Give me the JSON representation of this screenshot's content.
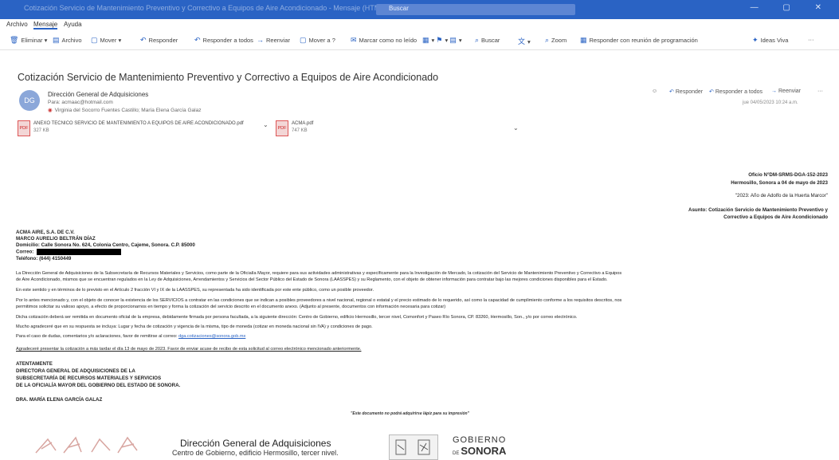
{
  "window": {
    "title": "Cotización Servicio de Mantenimiento Preventivo y Correctivo a Equipos de Aire Acondicionado - Mensaje (HTML)",
    "search_placeholder": "Buscar"
  },
  "menu": [
    "Archivo",
    "Mensaje",
    "Ayuda"
  ],
  "ribbon": {
    "eliminar": "Eliminar",
    "archivo": "Archivo",
    "mover": "Mover",
    "responder": "Responder",
    "responder_todos": "Responder a todos",
    "reenviar": "Reenviar",
    "mover1": "Mover a ?",
    "marcar": "Marcar como no leído",
    "buscar": "Buscar",
    "zoom": "Zoom",
    "responder_reunion": "Responder con reunión de programación",
    "ideas": "Ideas Viva",
    "more": "···"
  },
  "email": {
    "subject": "Cotización Servicio de Mantenimiento Preventivo y Correctivo a Equipos de Aire Acondicionado",
    "sender_initials": "DG",
    "sender_name": "Dirección General de Adquisiciones",
    "sender_email": "Para: acmaac@hotmail.com",
    "to_line": "Virginia del Socorro Fuentes Castillo; María Elena García Galaz",
    "actions": {
      "reply": "Responder",
      "reply_all": "Responder a todos",
      "forward": "Reenviar",
      "more": "···"
    },
    "date": "jue 04/05/2023 10:24 a.m.",
    "attachments": [
      {
        "name": "ANEXO TECNICO SERVICIO DE MANTENIMIENTO A EQUIPOS DE AIRE ACONDICIONADO.pdf",
        "size": "327 KB"
      },
      {
        "name": "ACMA.pdf",
        "size": "747 KB"
      }
    ]
  },
  "letter": {
    "oficio": "Oficio N°DM-SRMS-DGA-152-2023",
    "lugar_fecha": "Hermosillo, Sonora a 04 de mayo de 2023",
    "lema": "\"2023: Año de Adolfo de la Huerta Marcor\"",
    "asunto_1": "Asunto: Cotización Servicio de Mantenimiento Preventivo y",
    "asunto_2": "Correctivo a Equipos de Aire Acondicionado",
    "dest_1": "ACMA AIRE, S.A. DE C.V.",
    "dest_2": "MARCO AURELIO BELTRÁN DÍAZ",
    "dest_3": "Domicilio: Calle Sonora No. 624, Colonia Centro, Cajeme, Sonora. C.P. 85000",
    "dest_4": "Correo:",
    "dest_5": "Teléfono: (644) 4150449",
    "p1_a": "La Dirección General de Adquisiciones de la Subsecretaría de Recursos Materiales y Servicios, como parte de la Oficialía Mayor, requiere para sus actividades administrativas y específicamente para la Investigación de Mercado, la cotización del Servicio de Mantenimiento Preventivo y Correctivo a Equipos",
    "p1_b": "de Aire Acondicionado, mismos que se encuentran regulados en la Ley de Adquisiciones, Arrendamientos y Servicios del Sector Público del Estado de Sonora (LAASSPES) y su Reglamento, con el objeto de obtener información para contratar bajo las mejores condiciones disponibles para el Estado.",
    "p2": "En este sentido y en términos de lo previsto en el Artículo 2 fracción VI y IX de la LAASSPES, su representada ha sido identificada por este ente público, como un posible proveedor.",
    "p3_a": "Por lo antes mencionado y, con el objeto de conocer la existencia de los SERVICIOS a contratar en las condiciones que se indican a posibles proveedores a nivel nacional, regional o estatal y el precio estimado de lo requerido, así como la capacidad de cumplimiento conforme a los requisitos descritos, nos",
    "p3_b": "permitimos solicitar su valioso apoyo, a efecto de proporcionarnos en tiempo y forma la cotización del servicio descrito en el documento anexo. (Adjunto al presente, documentos con información necesaria para cotizar)",
    "p4": "Dicha cotización deberá ser remitida en documento oficial de la empresa, debidamente firmada por persona facultada, a la siguiente dirección: Centro de Gobierno, edificio Hermosillo, tercer nivel, Comonfort y Paseo Río Sonora, CP. 83260, Hermosillo, Son., y/o por correo electrónico.",
    "p5": "Mucho agradeceré que en su respuesta se incluya: Lugar y fecha de cotización y vigencia de la misma, tipo de moneda (cotizar en moneda nacional sin IVA) y condiciones de pago.",
    "p6": "Para el caso de dudas, comentarios y/o aclaraciones, favor de remitirse al correo:",
    "p6_link": "dga.cotizaciones@sonora.gob.mx",
    "p7": "Agradeceré presentar la cotización a más tardar el día 13 de mayo de 2023. Favor de enviar acuse de recibo de esta solicitud al correo electrónico mencionado anteriormente.",
    "firma_1": "ATENTAMENTE",
    "firma_2": "DIRECTORA GENERAL DE ADQUISICIONES DE LA",
    "firma_3": "SUBSECRETARÍA DE RECURSOS MATERIALES Y SERVICIOS",
    "firma_4": "DE LA OFICIALÍA MAYOR DEL GOBIERNO DEL ESTADO DE SONORA.",
    "firma_5": "DRA. MARÍA ELENA GARCÍA GALAZ",
    "nota": "\"Este documento no podrá adquirirse lápiz para su impresión\""
  },
  "footer": {
    "title": "Dirección General de Adquisiciones",
    "subtitle": "Centro de Gobierno, edificio Hermosillo, tercer nivel.",
    "gob_1": "GOBIERNO",
    "gob_prefix": "DE",
    "gob_2": "SONORA"
  },
  "colors": {
    "accent": "#2a63c4",
    "titlebar": "#2a63c4"
  }
}
